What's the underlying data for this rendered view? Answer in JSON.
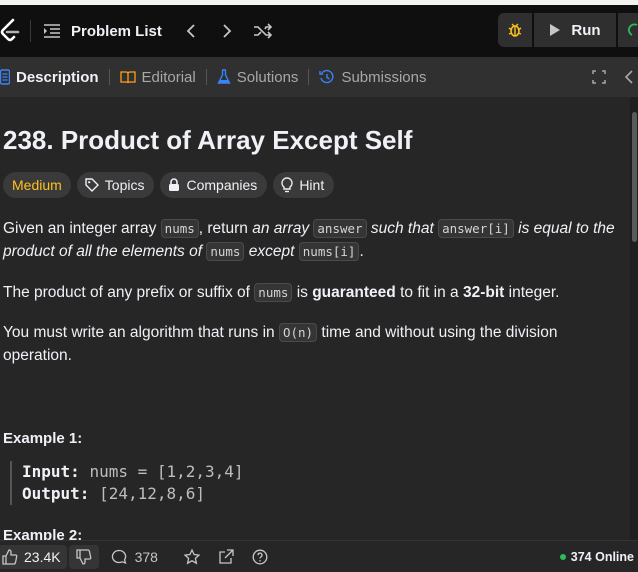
{
  "topnav": {
    "problem_list_label": "Problem List",
    "run_label": "Run"
  },
  "tabs": [
    {
      "label": "Description",
      "active": true,
      "icon": "description-icon"
    },
    {
      "label": "Editorial",
      "active": false,
      "icon": "book-icon"
    },
    {
      "label": "Solutions",
      "active": false,
      "icon": "flask-icon"
    },
    {
      "label": "Submissions",
      "active": false,
      "icon": "history-icon"
    }
  ],
  "problem": {
    "title": "238. Product of Array Except Self",
    "difficulty": "Medium",
    "chips": {
      "topics": "Topics",
      "companies": "Companies",
      "hint": "Hint"
    },
    "p1": {
      "t1": "Given an integer array ",
      "c1": "nums",
      "t2": ", return ",
      "t3": "an array",
      "c2": "answer",
      "t4": "such that",
      "c3": "answer[i]",
      "t5": "is equal to the product of all the elements of",
      "c4": "nums",
      "t6": "except",
      "c5": "nums[i]",
      "t7": "."
    },
    "p2": {
      "t1": "The product of any prefix or suffix of ",
      "c1": "nums",
      "t2": " is ",
      "b1": "guaranteed",
      "t3": " to fit in a ",
      "b2": "32-bit",
      "t4": " integer."
    },
    "p3": {
      "t1": "You must write an algorithm that runs in ",
      "c1": "O(n)",
      "t2": " time and without using the division operation."
    },
    "example1": {
      "heading": "Example 1:",
      "input_label": "Input:",
      "input_value": "nums = [1,2,3,4]",
      "output_label": "Output:",
      "output_value": "[24,12,8,6]"
    },
    "example2_heading": "Example 2:"
  },
  "bottom": {
    "likes": "23.4K",
    "comments": "378",
    "online": "374 Online"
  },
  "colors": {
    "medium": "#ffc01e",
    "online_dot": "#2cbb5d",
    "description_icon": "#3b82f6",
    "editorial_icon": "#ffa116",
    "solutions_icon": "#3b82f6",
    "submissions_icon": "#3b82f6",
    "submit_green": "#2cbb5d"
  }
}
